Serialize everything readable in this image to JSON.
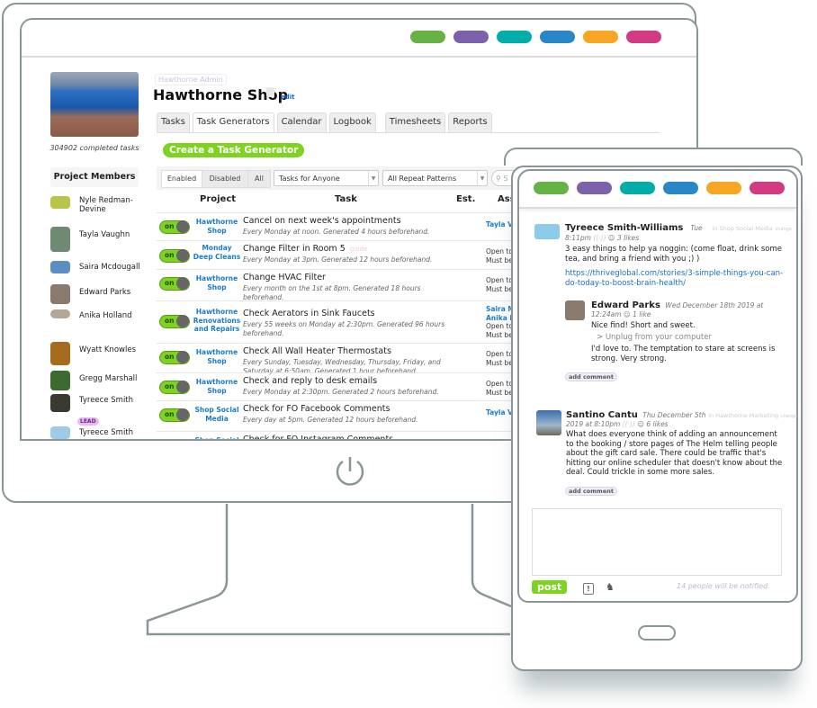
{
  "pill_colors": [
    "#66b245",
    "#7c62ab",
    "#00ada8",
    "#2987c8",
    "#f6a623",
    "#d23a82"
  ],
  "sidebar": {
    "completed_tasks": "304902 completed tasks",
    "members_heading": "Project Members",
    "members": [
      {
        "name": "Nyle Redman-Devine",
        "color": "#b8c44a"
      },
      {
        "name": "Tayla Vaughn",
        "color": "#6f8a72"
      },
      {
        "name": "Saira Mcdougall",
        "color": "#5b8fc2"
      },
      {
        "name": "Edward Parks",
        "color": "#8a7a6e"
      },
      {
        "name": "Anika Holland",
        "color": "#b5a795"
      },
      {
        "name": "Wyatt Knowles",
        "color": "#a66a1e"
      },
      {
        "name": "Gregg Marshall",
        "color": "#3b6b2e"
      },
      {
        "name": "Tyreece Smith",
        "color": "#3a3a30"
      },
      {
        "name": "Tyreece Smith",
        "color": "#9ecbe6"
      }
    ],
    "lead_badge": "LEAD"
  },
  "header": {
    "admin_tag": "Hawthorne Admin",
    "title": "Hawthorne Shop",
    "edit_link": "edit"
  },
  "tabs": [
    {
      "label": "Tasks",
      "active": false
    },
    {
      "label": "Task Generators",
      "active": true
    },
    {
      "label": "Calendar",
      "active": false
    },
    {
      "label": "Logbook",
      "active": false
    },
    {
      "label": "Timesheets",
      "active": false
    },
    {
      "label": "Reports",
      "active": false
    }
  ],
  "create_button": "Create a Task Generator",
  "filters": {
    "segments": [
      "Enabled",
      "Disabled",
      "All"
    ],
    "assignee_select": "Tasks for Anyone",
    "pattern_select": "All Repeat Patterns",
    "search_placeholder": "S"
  },
  "table": {
    "headers": {
      "project": "Project",
      "task": "Task",
      "est": "Est.",
      "assignee": "Ass"
    },
    "rows": [
      {
        "toggle": "on",
        "project": "Hawthorne Shop",
        "title": "Cancel on next week's appointments",
        "guide": "",
        "desc": "Every Monday at noon. Generated 4 hours beforehand.",
        "assignee_links": [
          "Tayla V"
        ],
        "assignee_text": []
      },
      {
        "toggle": "on",
        "project": "Monday Deep Cleans",
        "title": "Change Filter in Room 5",
        "guide": "guide",
        "desc": "Every Monday at 3pm. Generated 12 hours beforehand.",
        "assignee_links": [],
        "assignee_text": [
          "Open to",
          "Must be"
        ]
      },
      {
        "toggle": "on",
        "project": "Hawthorne Shop",
        "title": "Change HVAC Filter",
        "guide": "",
        "desc": "Every month on the 1st at 8pm. Generated 18 hours beforehand.",
        "assignee_links": [],
        "assignee_text": [
          "Open to",
          "Must be"
        ]
      },
      {
        "toggle": "on",
        "project": "Hawthorne Renovations and Repairs",
        "title": "Check Aerators in Sink Faucets",
        "guide": "",
        "desc": "Every 55 weeks on Monday at 2:30pm. Generated 96 hours beforehand.",
        "assignee_links": [
          "Saira M",
          "Anika H"
        ],
        "assignee_text": [
          "Open to",
          "Must be"
        ]
      },
      {
        "toggle": "on",
        "project": "Hawthorne Shop",
        "title": "Check All Wall Heater Thermostats",
        "guide": "",
        "desc": "Every Sunday, Tuesday, Wednesday, Thursday, Friday, and Saturday at 6:50am. Generated 1 hour beforehand.",
        "assignee_links": [],
        "assignee_text": [
          "Open to",
          "Must be"
        ]
      },
      {
        "toggle": "on",
        "project": "Hawthorne Shop",
        "title": "Check and reply to desk emails",
        "guide": "",
        "desc": "Every Monday at 2:30pm. Generated 2 hours beforehand.",
        "assignee_links": [],
        "assignee_text": [
          "Open to",
          "Must be"
        ]
      },
      {
        "toggle": "on",
        "project": "Shop Social Media",
        "title": "Check for FO Facebook Comments",
        "guide": "",
        "desc": "Every day at 5pm. Generated 12 hours beforehand.",
        "assignee_links": [
          "Tayla V"
        ],
        "assignee_text": []
      },
      {
        "toggle": "on",
        "project": "Shop Social",
        "title": "Check for FO Instagram Comments",
        "guide": "",
        "desc": "",
        "assignee_links": [],
        "assignee_text": []
      }
    ]
  },
  "feed": {
    "posts": [
      {
        "author": "Tyreece Smith-Williams",
        "date_a": "Tue",
        "date_b": "8:11pm",
        "likes": "3 likes",
        "project": "in Shop Social Media",
        "change": "change",
        "body": "3 easy things to help ya noggin: (come float, drink some tea, and bring a friend with you ;) )",
        "link": "https://thriveglobal.com/stories/3-simple-things-you-can-do-today-to-boost-brain-health/",
        "comment": {
          "author": "Edward Parks",
          "date_a": "Wed December 18th 2019 at",
          "date_b": "12:24am",
          "likes": "1 like",
          "line1": "Nice find! Short and sweet.",
          "quote": "> Unplug from your computer",
          "line2": "I'd love to. The temptation to stare at screens is strong. Very strong."
        },
        "add_comment": "add comment"
      },
      {
        "author": "Santino Cantu",
        "date_a": "Thu December 5th",
        "date_b": "2019 at 8:10pm",
        "likes": "6 likes",
        "project": "in Hawthorne Marketing",
        "change": "change",
        "body": "What does everyone think of adding an announcement to the booking / store pages of The Helm telling people about the gift card sale. There could be traffic that's hitting our online scheduler that doesn't know about the deal. Could trickle in some more sales.",
        "add_comment": "add comment"
      }
    ],
    "composer_placeholder": "",
    "post_button": "post",
    "notified": "14 people will be notified."
  }
}
